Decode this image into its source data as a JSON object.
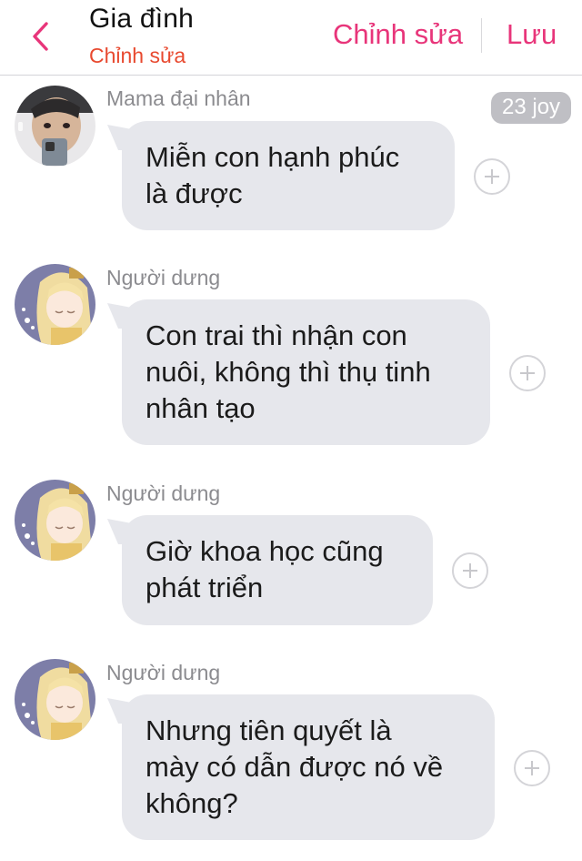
{
  "header": {
    "title": "Gia đình",
    "subtitle": "Chỉnh sửa",
    "edit_label": "Chỉnh sửa",
    "save_label": "Lưu",
    "accent_color": "#e8357a",
    "subtitle_color": "#e8492f"
  },
  "messages": [
    {
      "sender": "Mama đại nhân",
      "lines": [
        "Miễn con hạnh phúc",
        "là được"
      ],
      "badge": "23 joy",
      "avatar": "user-photo-avatar"
    },
    {
      "sender": "Người dưng",
      "lines": [
        "Con trai thì nhận con",
        "nuôi, không thì thụ tinh",
        "nhân tạo"
      ],
      "avatar": "anime-girl-avatar"
    },
    {
      "sender": "Người dưng",
      "lines": [
        "Giờ khoa học cũng",
        "phát triển"
      ],
      "avatar": "anime-girl-avatar"
    },
    {
      "sender": "Người dưng",
      "lines": [
        "Nhưng tiên quyết là",
        "mày có dẫn được nó về",
        "không?"
      ],
      "avatar": "anime-girl-avatar"
    }
  ],
  "icons": {
    "back": "chevron-left-icon",
    "react": "plus-circle-icon"
  }
}
